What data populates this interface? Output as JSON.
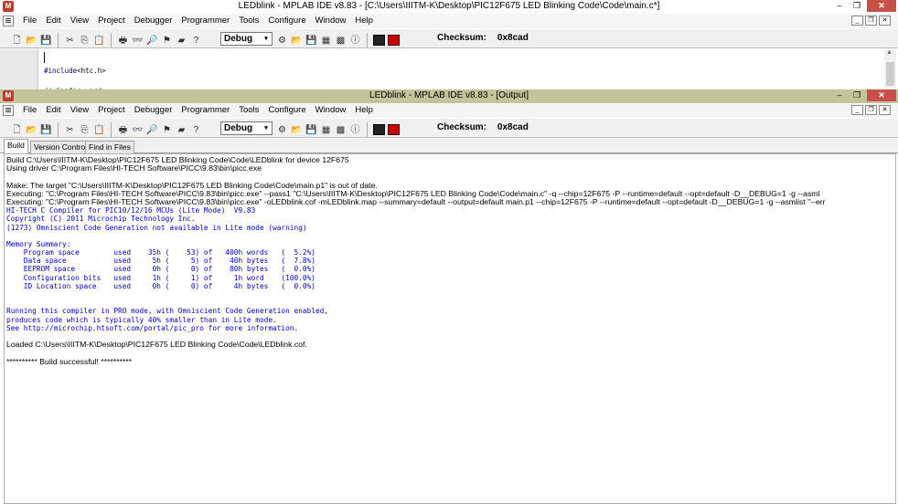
{
  "main_window": {
    "title": "LEDblink - MPLAB IDE v8.83 - [C:\\Users\\IIITM-K\\Desktop\\PIC12F675 LED Blinking Code\\Code\\main.c*]",
    "app_icon_label": "M",
    "title_bar_colors": {
      "active": "#ffffff",
      "close": "#c7504a"
    }
  },
  "output_window": {
    "title": "LEDblink - MPLAB IDE v8.83 - [Output]",
    "title_bar_color": "#c4c49a"
  },
  "window_controls": {
    "minimize": "‒",
    "maximize": "❐",
    "close": "✕"
  },
  "mdi_controls": {
    "minimize": "_",
    "restore": "❐",
    "close": "✕"
  },
  "menu": [
    "File",
    "Edit",
    "View",
    "Project",
    "Debugger",
    "Programmer",
    "Tools",
    "Configure",
    "Window",
    "Help"
  ],
  "toolbar": {
    "build_config": "Debug",
    "build_config_arrow": "▾",
    "checksum_label": "Checksum:",
    "checksum_value": "0x8cad",
    "tool_icons": {
      "new": "🗋",
      "open": "📂",
      "save": "💾",
      "cut": "✂",
      "copy": "⎘",
      "paste": "📋",
      "print": "🖶",
      "find": "👓",
      "find_in_files": "🔎",
      "bookmark": "⚑",
      "toggle": "▰",
      "help": "?",
      "build_wizard": "⚙",
      "open_project": "📂",
      "save_project": "💾",
      "build": "▦",
      "build_all": "▩",
      "info": "ⓘ"
    }
  },
  "editor": {
    "include_keyword": "#include",
    "include_file": "<htc.h>",
    "comment": "// Config word"
  },
  "tabs": [
    "Build",
    "Version Control",
    "Find in Files"
  ],
  "output_lines": [
    {
      "style": "sans",
      "text": "Build C:\\Users\\IIITM-K\\Desktop\\PIC12F675 LED Blinking Code\\Code\\LEDblink for device 12F675"
    },
    {
      "style": "sans",
      "text": "Using driver C:\\Program Files\\HI-TECH Software\\PICC\\9.83\\bin\\picc.exe"
    },
    {
      "style": "blank",
      "text": ""
    },
    {
      "style": "sans",
      "text": "Make: The target \"C:\\Users\\IIITM-K\\Desktop\\PIC12F675 LED Blinking Code\\Code\\main.p1\" is out of date."
    },
    {
      "style": "sans",
      "text": "Executing: \"C:\\Program Files\\HI-TECH Software\\PICC\\9.83\\bin\\picc.exe\" --pass1 \"C:\\Users\\IIITM-K\\Desktop\\PIC12F675 LED Blinking Code\\Code\\main.c\" -q --chip=12F675 -P --runtime=default --opt=default -D__DEBUG=1 -g --asml"
    },
    {
      "style": "sans",
      "text": "Executing: \"C:\\Program Files\\HI-TECH Software\\PICC\\9.83\\bin\\picc.exe\" -oLEDblink.cof -mLEDblink.map --summary=default --output=default main.p1 --chip=12F675 -P --runtime=default --opt=default -D__DEBUG=1 -g --asmlist \"--err"
    },
    {
      "style": "mono",
      "text": "HI-TECH C Compiler for PIC10/12/16 MCUs (Lite Mode)  V9.83"
    },
    {
      "style": "mono",
      "text": "Copyright (C) 2011 Microchip Technology Inc."
    },
    {
      "style": "mono",
      "text": "(1273) Omniscient Code Generation not available in Lite mode (warning)"
    },
    {
      "style": "blank",
      "text": ""
    },
    {
      "style": "mono",
      "text": "Memory Summary:"
    },
    {
      "style": "mono",
      "text": "    Program space        used    35h (    53) of   400h words   (  5.2%)"
    },
    {
      "style": "mono",
      "text": "    Data space           used     5h (     5) of    40h bytes   (  7.8%)"
    },
    {
      "style": "mono",
      "text": "    EEPROM space         used     0h (     0) of    80h bytes   (  0.0%)"
    },
    {
      "style": "mono",
      "text": "    Configuration bits   used     1h (     1) of     1h word    (100.0%)"
    },
    {
      "style": "mono",
      "text": "    ID Location space    used     0h (     0) of     4h bytes   (  0.0%)"
    },
    {
      "style": "blank",
      "text": ""
    },
    {
      "style": "blank",
      "text": ""
    },
    {
      "style": "mono",
      "text": "Running this compiler in PRO mode, with Omniscient Code Generation enabled,"
    },
    {
      "style": "mono",
      "text": "produces code which is typically 40% smaller than in Lite mode."
    },
    {
      "style": "mono",
      "text": "See http://microchip.htsoft.com/portal/pic_pro for more information."
    },
    {
      "style": "blank",
      "text": ""
    },
    {
      "style": "sans",
      "text": "Loaded C:\\Users\\IIITM-K\\Desktop\\PIC12F675 LED Blinking Code\\Code\\LEDblink.cof."
    },
    {
      "style": "blank",
      "text": ""
    },
    {
      "style": "sans",
      "text": "********** Build successful! **********"
    }
  ]
}
